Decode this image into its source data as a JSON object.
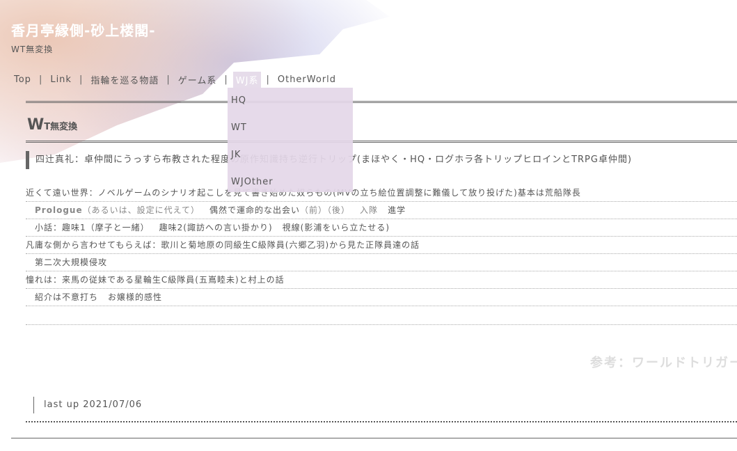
{
  "site": {
    "title": "香月亭縁側-砂上楼閣-",
    "subtitle": "WT無変換"
  },
  "nav": {
    "items": [
      {
        "label": "Top"
      },
      {
        "label": "Link"
      },
      {
        "label": "指輪を巡る物語"
      },
      {
        "label": "ゲーム系"
      },
      {
        "label": "WJ系"
      },
      {
        "label": "OtherWorld"
      }
    ],
    "separator": "|"
  },
  "dropdown": {
    "items": [
      "HQ",
      "WT",
      "JK",
      "WJOther"
    ]
  },
  "page": {
    "heading_big": "W",
    "heading_small": "T無変換",
    "quote": "四辻真礼：卓仲間にうっすら布教された程度の原作知識持ち逆行トリップ(まほやく・HQ・ログホラ各トリップヒロインとTRPG卓仲間)"
  },
  "list": {
    "row1": "近くて遠い世界：ノベルゲームのシナリオ起こしを見て書き始めた奴らもの(MVの立ち絵位置調整に難儀して放り投げた)基本は荒船隊長",
    "row2": {
      "prologue": "Prologue",
      "prologue_note": "（あるいは、設定に代えて）",
      "meeting": "偶然で運命的な出会い",
      "first": "（前）",
      "second": "（後）",
      "join": "入隊",
      "advance": "進学"
    },
    "row3": {
      "a": "小話：趣味1（摩子と一緒）",
      "b": "趣味2(諏訪への言い掛かり)",
      "c": "視線(影浦をいら立たせる)"
    },
    "row4": "凡庸な側から言わせてもらえば：歌川と菊地原の同級生C級隊員(六郷乙羽)から見た正隊員達の話",
    "row5": "第二次大規模侵攻",
    "row6": "憧れは：来馬の従妹である星輪生C級隊員(五嶌睦未)と村上の話",
    "row7": {
      "a": "紹介は不意打ち",
      "b": "お嬢様的感性"
    }
  },
  "reference": "参考：ワールドトリガー",
  "footer": {
    "last_up": "last up 2021/07/06"
  }
}
